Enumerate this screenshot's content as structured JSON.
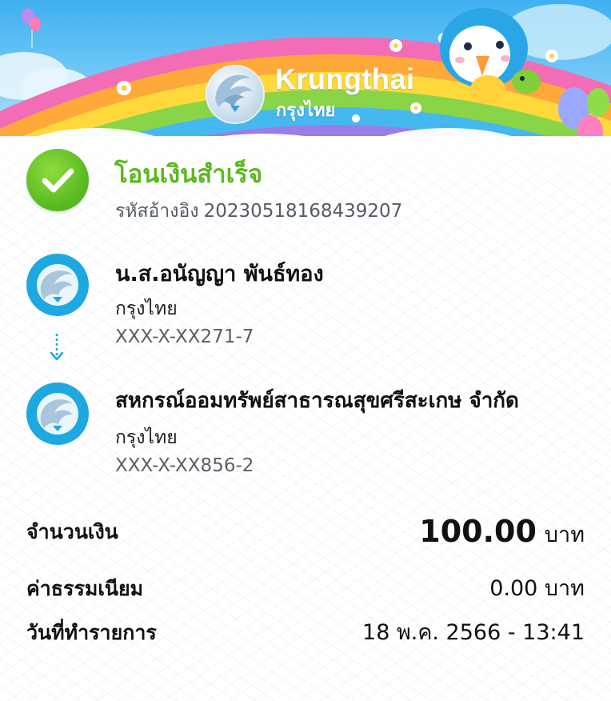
{
  "header": {
    "brand_en": "Krungthai",
    "brand_th": "กรุงไทย"
  },
  "status": {
    "title": "โอนเงินสำเร็จ",
    "ref_label": "รหัสอ้างอิง",
    "ref_number": "20230518168439207",
    "icon": "check-circle-icon",
    "color": "#5cb81f"
  },
  "sender": {
    "name": "น.ส.อนัญญา พันธ์ทอง",
    "bank": "กรุงไทย",
    "account": "XXX-X-XX271-7"
  },
  "receiver": {
    "name": "สหกรณ์ออมทรัพย์สาธารณสุขศรีสะเกษ จำกัด",
    "bank": "กรุงไทย",
    "account": "XXX-X-XX856-2"
  },
  "details": {
    "amount_label": "จำนวนเงิน",
    "amount_value": "100.00",
    "amount_unit": "บาท",
    "fee_label": "ค่าธรรมเนียม",
    "fee_value": "0.00 บาท",
    "date_label": "วันที่ทำรายการ",
    "date_value": "18 พ.ค. 2566 - 13:41"
  },
  "colors": {
    "accent_green": "#5cb81f",
    "bank_blue": "#1ea8e0",
    "sky": "#3fb0f0"
  }
}
